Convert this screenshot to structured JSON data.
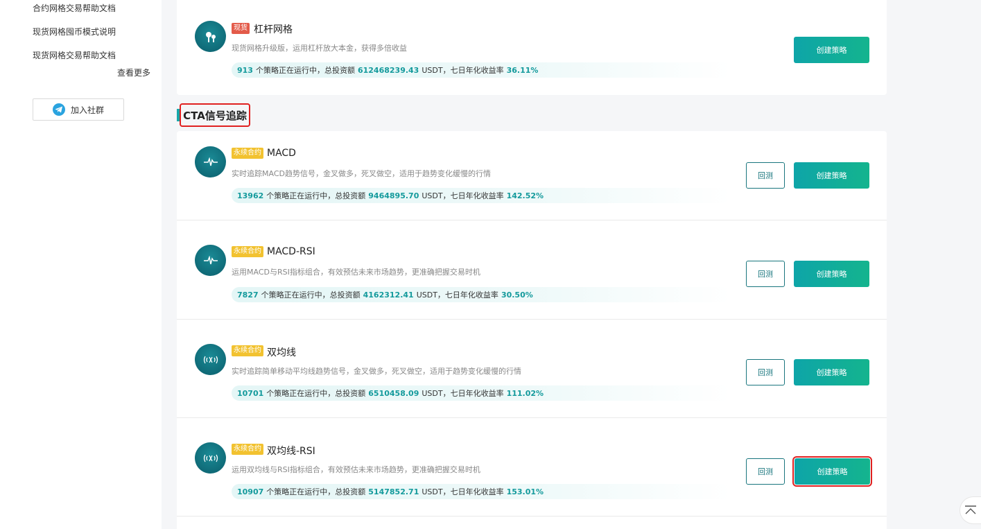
{
  "sidebar": {
    "links": [
      "合约网格交易帮助文档",
      "现货网格囤币模式说明",
      "现货网格交易帮助文档"
    ],
    "more_label": "查看更多",
    "join_label": "加入社群",
    "join_icon": "telegram-icon"
  },
  "top_card": {
    "tag": "现货",
    "title": "杠杆网格",
    "desc": "现货网格升级版，运用杠杆放大本金，获得多倍收益",
    "running": "913",
    "running_text": "个策略正在运行中，总投资额",
    "invested": "612468239.43",
    "unit_text": "USDT，七日年化收益率",
    "apy": "36.11%",
    "create_label": "创建策略"
  },
  "section": {
    "title": "CTA信号追踪"
  },
  "strategies": [
    {
      "tag": "永续合约",
      "title": "MACD",
      "desc": "实时追踪MACD趋势信号，金叉做多，死叉做空，适用于趋势变化缓慢的行情",
      "running": "13962",
      "running_text": "个策略正在运行中，总投资额",
      "invested": "9464895.70",
      "unit_text": "USDT，七日年化收益率",
      "apy": "142.52%",
      "test_label": "回测",
      "create_label": "创建策略"
    },
    {
      "tag": "永续合约",
      "title": "MACD-RSI",
      "desc": "运用MACD与RSI指标组合，有效预估未来市场趋势，更准确把握交易时机",
      "running": "7827",
      "running_text": "个策略正在运行中，总投资额",
      "invested": "4162312.41",
      "unit_text": "USDT，七日年化收益率",
      "apy": "30.50%",
      "test_label": "回测",
      "create_label": "创建策略"
    },
    {
      "tag": "永续合约",
      "title": "双均线",
      "desc": "实时追踪简单移动平均线趋势信号，金叉做多，死叉做空，适用于趋势变化缓慢的行情",
      "running": "10701",
      "running_text": "个策略正在运行中，总投资额",
      "invested": "6510458.09",
      "unit_text": "USDT，七日年化收益率",
      "apy": "111.02%",
      "test_label": "回测",
      "create_label": "创建策略"
    },
    {
      "tag": "永续合约",
      "title": "双均线-RSI",
      "desc": "运用双均线与RSI指标组合，有效预估未来市场趋势，更准确把握交易时机",
      "running": "10907",
      "running_text": "个策略正在运行中，总投资额",
      "invested": "5147852.71",
      "unit_text": "USDT，七日年化收益率",
      "apy": "153.01%",
      "test_label": "回测",
      "create_label": "创建策略"
    }
  ],
  "colors": {
    "accent": "#0ea5a8",
    "perp_tag": "#f2c230",
    "spot_tag": "#e35b4a",
    "highlight": "#e02020"
  }
}
